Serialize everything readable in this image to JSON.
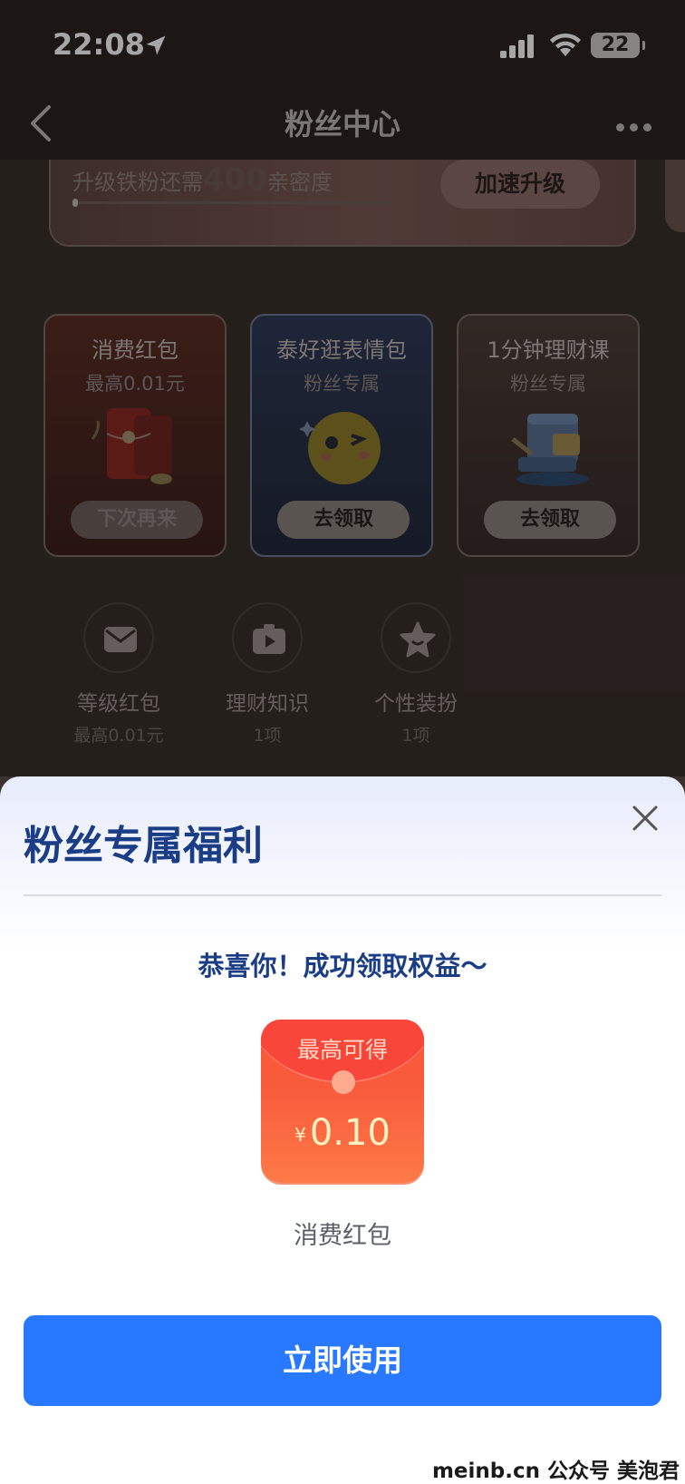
{
  "status_bar": {
    "time": "22:08",
    "battery": "22"
  },
  "nav": {
    "title": "粉丝中心"
  },
  "level": {
    "text_prefix": "升级铁粉还需",
    "points": "400",
    "text_suffix": "亲密度",
    "button": "加速升级"
  },
  "benefits": [
    {
      "title": "消费红包",
      "sub": "最高0.01元",
      "button": "下次再来",
      "icon": "red-packet-icon"
    },
    {
      "title": "泰好逛表情包",
      "sub": "粉丝专属",
      "button": "去领取",
      "icon": "emoji-wink-icon"
    },
    {
      "title": "1分钟理财课",
      "sub": "粉丝专属",
      "button": "去领取",
      "icon": "calendar-book-icon"
    }
  ],
  "small_items": [
    {
      "label": "等级红包",
      "sub": "最高0.01元",
      "icon": "envelope-icon"
    },
    {
      "label": "理财知识",
      "sub": "1项",
      "icon": "play-video-icon"
    },
    {
      "label": "个性装扮",
      "sub": "1项",
      "icon": "star-icon"
    }
  ],
  "sheet": {
    "title": "粉丝专属福利",
    "congrats": "恭喜你！成功领取权益～",
    "packet_label": "最高可得",
    "currency": "¥",
    "amount": "0.10",
    "packet_name": "消费红包",
    "use_button": "立即使用"
  },
  "watermark": "meinb.cn  公众号 美泡君",
  "colors": {
    "accent": "#2879ff",
    "title_blue": "#1a3d86",
    "packet_red": "#f8473a"
  }
}
